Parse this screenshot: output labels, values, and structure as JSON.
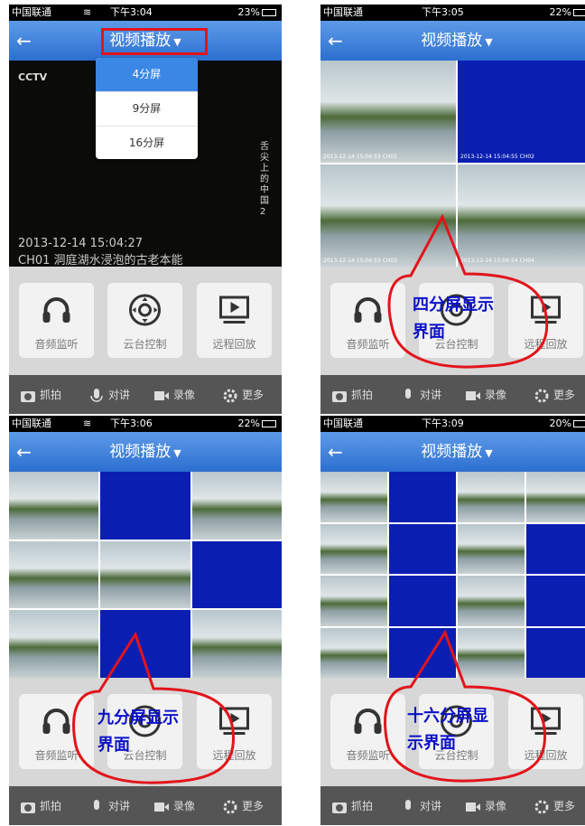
{
  "panels": [
    {
      "status": {
        "carrier": "中国联通",
        "time": "下午3:04",
        "battery": "23%"
      },
      "title": "视频播放",
      "dropdown": [
        "4分屏",
        "9分屏",
        "16分屏"
      ],
      "dropdown_selected": 0,
      "video": {
        "logo": "CCTV",
        "timestamp": "2013-12-14 15:04:27",
        "caption": "CH01 洞庭湖水浸泡的古老本能",
        "vertical_text": "舌尖上的中国2"
      }
    },
    {
      "status": {
        "carrier": "中国联通",
        "time": "下午3:05",
        "battery": "22%"
      },
      "title": "视频播放",
      "callout": [
        "四分屏显示",
        "界面"
      ],
      "cells": [
        {
          "label": "2013-12-14 15:04:53 CH01"
        },
        {
          "label": "2013-12-14 15:04:55 CH02"
        },
        {
          "label": "2013-12-14 15:04:53 CH03"
        },
        {
          "label": "2013-12-14 15:04:54 CH04"
        }
      ]
    },
    {
      "status": {
        "carrier": "中国联通",
        "time": "下午3:06",
        "battery": "22%"
      },
      "title": "视频播放",
      "callout": [
        "九分屏显示",
        "界面"
      ]
    },
    {
      "status": {
        "carrier": "中国联通",
        "time": "下午3:09",
        "battery": "20%"
      },
      "title": "视频播放",
      "callout": [
        "十六分屏显",
        "示界面"
      ]
    }
  ],
  "buttons": {
    "audio": "音频监听",
    "ptz": "云台控制",
    "playback": "远程回放"
  },
  "toolbar": {
    "snapshot": "抓拍",
    "talk": "对讲",
    "record": "录像",
    "more": "更多"
  },
  "colors": {
    "nav": "#2c6fd0",
    "blue_cell": "#0a1fb2",
    "callout_red": "#e2141b",
    "callout_text": "#0a10c8"
  }
}
